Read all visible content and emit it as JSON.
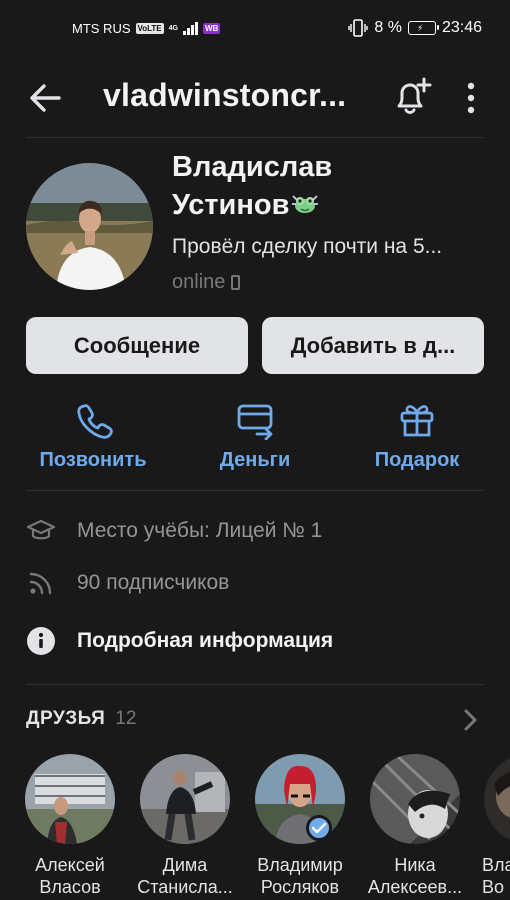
{
  "status_bar": {
    "carrier": "MTS RUS",
    "volte": "VoLTE",
    "network": "4G",
    "wb_badge": "WB",
    "battery": "8 %",
    "time": "23:46"
  },
  "header": {
    "title": "vladwinstoncr...",
    "icons": [
      "back-arrow-icon",
      "bell-plus-icon",
      "more-vertical-icon"
    ]
  },
  "profile": {
    "name_line1": "Владислав",
    "name_line2": "Устинов",
    "status": "Провёл сделку почти на 5...",
    "online": "online"
  },
  "buttons": {
    "message": "Сообщение",
    "add_friend": "Добавить в д..."
  },
  "actions": [
    {
      "label": "Позвонить",
      "icon": "phone-icon"
    },
    {
      "label": "Деньги",
      "icon": "money-transfer-icon"
    },
    {
      "label": "Подарок",
      "icon": "gift-icon"
    }
  ],
  "info": {
    "education": "Место учёбы: Лицей № 1",
    "followers": "90 подписчиков",
    "details": "Подробная информация"
  },
  "friends": {
    "header": "ДРУЗЬЯ",
    "count": "12",
    "items": [
      {
        "first": "Алексей",
        "last": "Власов"
      },
      {
        "first": "Дима",
        "last": "Станисла..."
      },
      {
        "first": "Владимир",
        "last": "Росляков"
      },
      {
        "first": "Ника",
        "last": "Алексеев..."
      },
      {
        "first": "Вла",
        "last": "Во"
      }
    ]
  },
  "colors": {
    "background": "#19191a",
    "accent": "#71aaeb",
    "button_bg": "#e1e3e6",
    "secondary_text": "#76787a"
  }
}
